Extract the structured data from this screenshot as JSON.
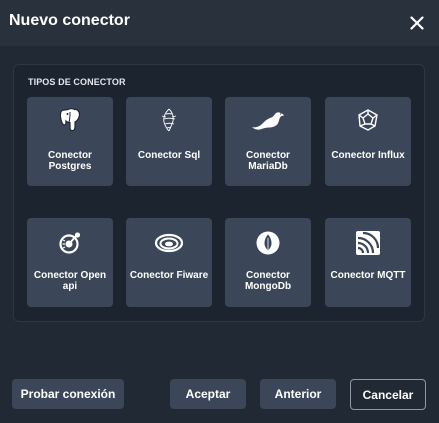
{
  "dialog": {
    "title": "Nuevo conector",
    "close_icon": "close-icon"
  },
  "section": {
    "label": "TIPOS DE CONECTOR"
  },
  "connectors": [
    {
      "label": "Conector Postgres",
      "icon": "postgres-elephant-icon"
    },
    {
      "label": "Conector Sql",
      "icon": "sql-server-icon"
    },
    {
      "label": "Conector MariaDb",
      "icon": "mariadb-seal-icon"
    },
    {
      "label": "Conector Influx",
      "icon": "influx-icon"
    },
    {
      "label": "Conector Open api",
      "icon": "openapi-icon"
    },
    {
      "label": "Conector Fiware",
      "icon": "fiware-icon"
    },
    {
      "label": "Conector MongoDb",
      "icon": "mongodb-leaf-icon"
    },
    {
      "label": "Conector MQTT",
      "icon": "mqtt-icon"
    }
  ],
  "footer": {
    "test_label": "Probar conexión",
    "accept_label": "Aceptar",
    "previous_label": "Anterior",
    "cancel_label": "Cancelar"
  },
  "colors": {
    "background": "#212934",
    "header": "#29313c",
    "panel": "#1c2430",
    "card": "#3b4758",
    "text": "#ffffff"
  }
}
